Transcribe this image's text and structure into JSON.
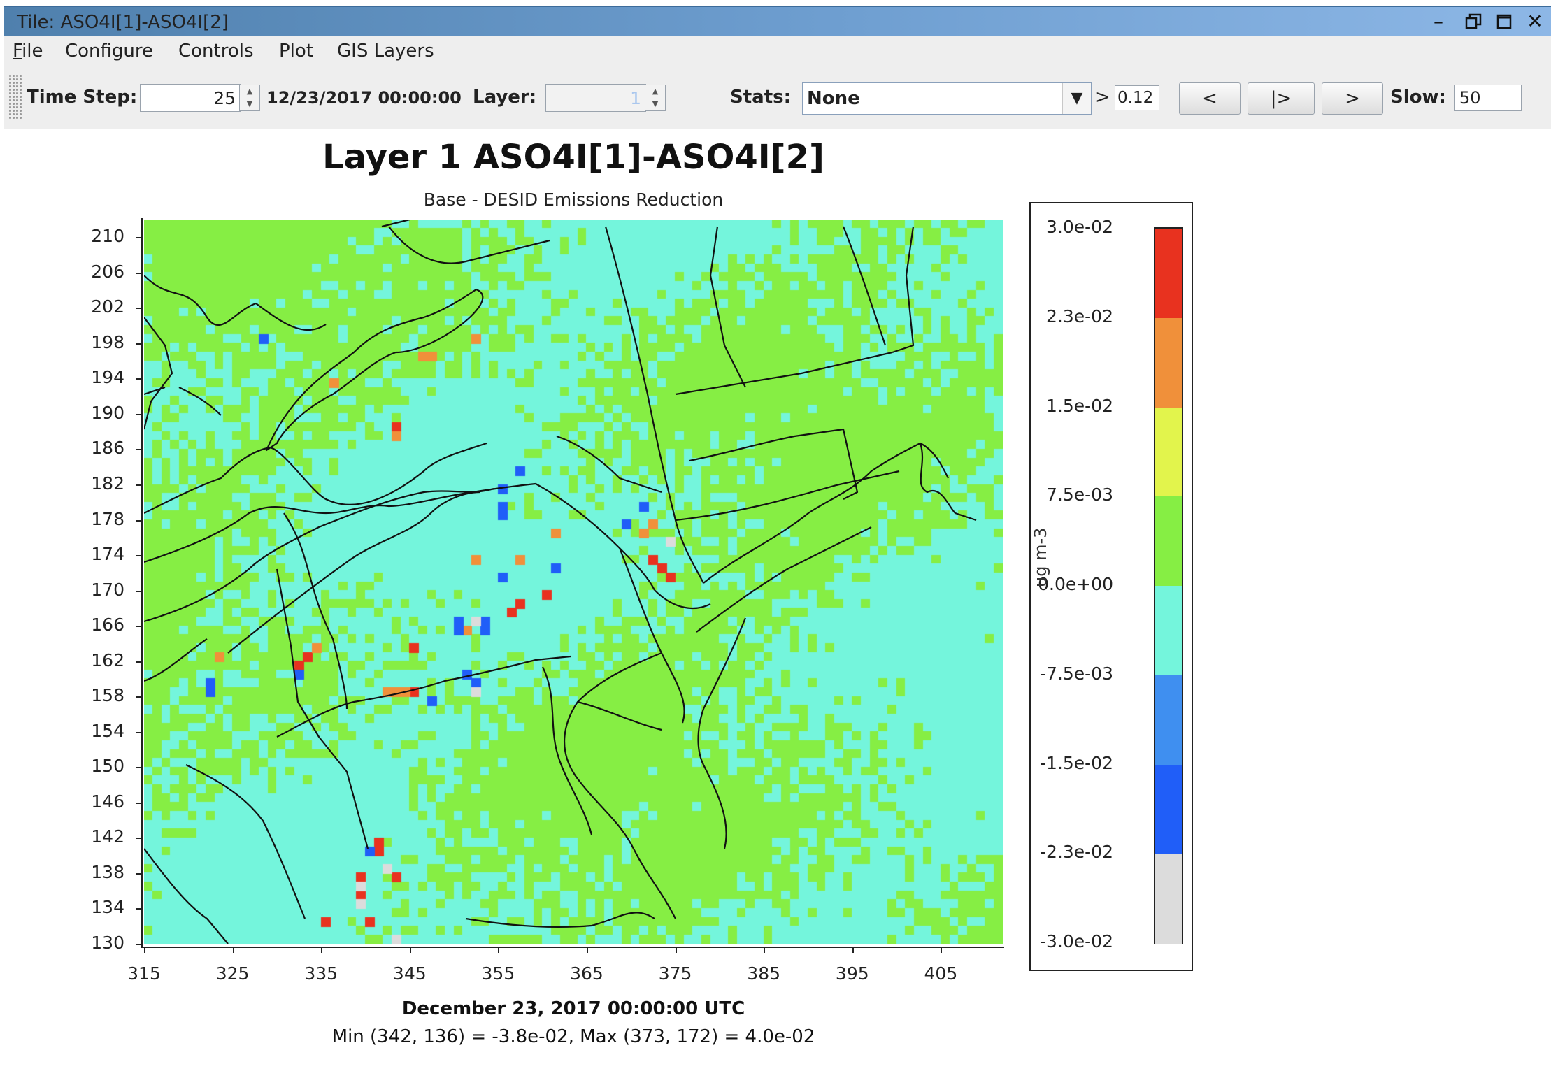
{
  "window": {
    "title": "Tile: ASO4I[1]-ASO4I[2]",
    "controls": [
      "minimize-icon",
      "restore-icon",
      "maximize-icon",
      "close-icon"
    ]
  },
  "menu": {
    "items": [
      {
        "label": "File",
        "underline": "F",
        "rest": "ile"
      },
      {
        "label": "Configure"
      },
      {
        "label": "Controls"
      },
      {
        "label": "Plot"
      },
      {
        "label": "GIS Layers"
      }
    ]
  },
  "toolbar": {
    "time_step_label": "Time Step:",
    "time_step_value": "25",
    "datetime": "12/23/2017 00:00:00",
    "layer_label": "Layer:",
    "layer_value": "1",
    "stats_label": "Stats:",
    "stats_value": "None",
    "gt_symbol": ">",
    "threshold_value": "0.12",
    "prev_label": "<",
    "step_label": "|>",
    "next_label": ">",
    "slow_label": "Slow:",
    "slow_value": "50"
  },
  "plot": {
    "title": "Layer 1 ASO4I[1]-ASO4I[2]",
    "subtitle": "Base - DESID Emissions Reduction",
    "y_ticks": [
      "210",
      "206",
      "202",
      "198",
      "194",
      "190",
      "186",
      "182",
      "178",
      "174",
      "170",
      "166",
      "162",
      "158",
      "154",
      "150",
      "146",
      "142",
      "138",
      "134",
      "130"
    ],
    "x_ticks": [
      "315",
      "325",
      "335",
      "345",
      "355",
      "365",
      "375",
      "385",
      "395",
      "405"
    ],
    "date_label": "December 23, 2017 00:00:00 UTC",
    "minmax_label": "Min (342, 136) = -3.8e-02, Max (373, 172) = 4.0e-02"
  },
  "legend": {
    "unit": "ug m-3",
    "labels": [
      "3.0e-02",
      "2.3e-02",
      "1.5e-02",
      "7.5e-03",
      "0.0e+00",
      "-7.5e-03",
      "-1.5e-02",
      "-2.3e-02",
      "-3.0e-02"
    ],
    "colors": [
      "#e8321f",
      "#f0903a",
      "#e2f44c",
      "#86ee44",
      "#74f5dc",
      "#3f8ff0",
      "#205ef8",
      "#dcdcdc"
    ]
  },
  "chart_data": {
    "type": "heatmap",
    "title": "Layer 1 ASO4I[1]-ASO4I[2]",
    "subtitle": "Base - DESID Emissions Reduction",
    "xlim": [
      315,
      412
    ],
    "ylim": [
      130,
      212
    ],
    "x_ticks": [
      315,
      325,
      335,
      345,
      355,
      365,
      375,
      385,
      395,
      405
    ],
    "y_ticks": [
      130,
      134,
      138,
      142,
      146,
      150,
      154,
      158,
      162,
      166,
      170,
      174,
      178,
      182,
      186,
      190,
      194,
      198,
      202,
      206,
      210
    ],
    "colorbar": {
      "unit": "ug m-3",
      "min": -0.03,
      "max": 0.03,
      "levels": [
        -0.03,
        -0.023,
        -0.015,
        -0.0075,
        0.0,
        0.0075,
        0.015,
        0.023,
        0.03
      ]
    },
    "min": {
      "x": 342,
      "y": 136,
      "value": -0.038
    },
    "max": {
      "x": 373,
      "y": 172,
      "value": 0.04
    },
    "highlight_cells": [
      {
        "x": 373,
        "y": 172,
        "value": 0.03
      },
      {
        "x": 374,
        "y": 171,
        "value": 0.025
      },
      {
        "x": 372,
        "y": 173,
        "value": 0.03
      },
      {
        "x": 360,
        "y": 169,
        "value": 0.03
      },
      {
        "x": 357,
        "y": 168,
        "value": 0.03
      },
      {
        "x": 356,
        "y": 167,
        "value": 0.03
      },
      {
        "x": 341,
        "y": 140,
        "value": 0.03
      },
      {
        "x": 341,
        "y": 141,
        "value": 0.03
      },
      {
        "x": 339,
        "y": 137,
        "value": 0.03
      },
      {
        "x": 339,
        "y": 135,
        "value": 0.03
      },
      {
        "x": 335,
        "y": 132,
        "value": 0.03
      },
      {
        "x": 340,
        "y": 132,
        "value": 0.03
      },
      {
        "x": 332,
        "y": 161,
        "value": 0.03
      },
      {
        "x": 343,
        "y": 188,
        "value": 0.025
      },
      {
        "x": 333,
        "y": 162,
        "value": 0.025
      },
      {
        "x": 334,
        "y": 163,
        "value": 0.02
      },
      {
        "x": 350,
        "y": 165,
        "value": 0.025
      },
      {
        "x": 345,
        "y": 163,
        "value": 0.025
      },
      {
        "x": 345,
        "y": 158,
        "value": 0.025
      },
      {
        "x": 343,
        "y": 137,
        "value": 0.025
      },
      {
        "x": 372,
        "y": 177,
        "value": 0.015
      },
      {
        "x": 371,
        "y": 176,
        "value": 0.015
      },
      {
        "x": 361,
        "y": 176,
        "value": 0.015
      },
      {
        "x": 343,
        "y": 187,
        "value": 0.015
      },
      {
        "x": 347,
        "y": 196,
        "value": 0.015
      },
      {
        "x": 346,
        "y": 196,
        "value": 0.015
      },
      {
        "x": 352,
        "y": 198,
        "value": 0.015
      },
      {
        "x": 343,
        "y": 158,
        "value": 0.015
      },
      {
        "x": 344,
        "y": 158,
        "value": 0.015
      },
      {
        "x": 342,
        "y": 158,
        "value": 0.015
      },
      {
        "x": 357,
        "y": 173,
        "value": 0.015
      },
      {
        "x": 352,
        "y": 173,
        "value": 0.015
      },
      {
        "x": 351,
        "y": 165,
        "value": 0.015
      },
      {
        "x": 336,
        "y": 193,
        "value": 0.015
      },
      {
        "x": 323,
        "y": 162,
        "value": 0.015
      },
      {
        "x": 328,
        "y": 198,
        "value": -0.02
      },
      {
        "x": 322,
        "y": 159,
        "value": -0.02
      },
      {
        "x": 322,
        "y": 158,
        "value": -0.02
      },
      {
        "x": 332,
        "y": 160,
        "value": -0.02
      },
      {
        "x": 355,
        "y": 181,
        "value": -0.02
      },
      {
        "x": 355,
        "y": 179,
        "value": -0.02
      },
      {
        "x": 355,
        "y": 178,
        "value": -0.02
      },
      {
        "x": 371,
        "y": 179,
        "value": -0.02
      },
      {
        "x": 374,
        "y": 175,
        "value": -0.025
      },
      {
        "x": 369,
        "y": 177,
        "value": -0.02
      },
      {
        "x": 351,
        "y": 160,
        "value": -0.02
      },
      {
        "x": 350,
        "y": 165,
        "value": -0.02
      },
      {
        "x": 353,
        "y": 166,
        "value": -0.02
      },
      {
        "x": 353,
        "y": 165,
        "value": -0.02
      },
      {
        "x": 355,
        "y": 171,
        "value": -0.02
      },
      {
        "x": 361,
        "y": 172,
        "value": -0.02
      },
      {
        "x": 347,
        "y": 157,
        "value": -0.02
      },
      {
        "x": 339,
        "y": 136,
        "value": -0.025
      },
      {
        "x": 340,
        "y": 140,
        "value": -0.02
      },
      {
        "x": 339,
        "y": 134,
        "value": -0.025
      },
      {
        "x": 357,
        "y": 183,
        "value": -0.02
      },
      {
        "x": 352,
        "y": 159,
        "value": -0.02
      },
      {
        "x": 350,
        "y": 166,
        "value": -0.02
      },
      {
        "x": 343,
        "y": 130,
        "value": -0.03
      },
      {
        "x": 342,
        "y": 138,
        "value": -0.03
      },
      {
        "x": 352,
        "y": 166,
        "value": -0.03
      },
      {
        "x": 352,
        "y": 158,
        "value": -0.03
      }
    ]
  }
}
